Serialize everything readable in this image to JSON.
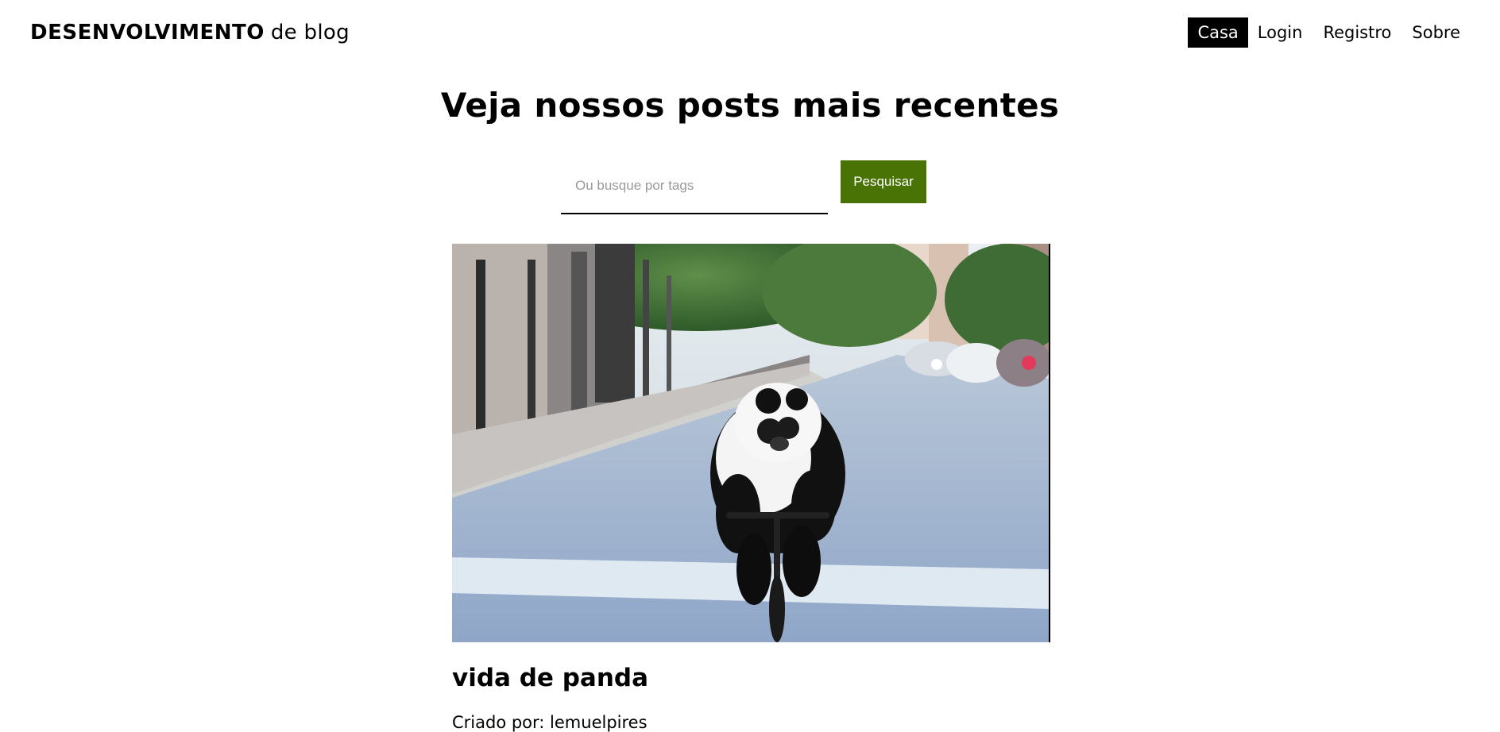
{
  "navbar": {
    "brand_bold": "DESENVOLVIMENTO",
    "brand_light": "de blog",
    "links": [
      {
        "label": "Casa",
        "active": true
      },
      {
        "label": "Login",
        "active": false
      },
      {
        "label": "Registro",
        "active": false
      },
      {
        "label": "Sobre",
        "active": false
      }
    ]
  },
  "main": {
    "title": "Veja nossos posts mais recentes",
    "search": {
      "placeholder": "Ou busque por tags",
      "value": "",
      "button_label": "Pesquisar"
    }
  },
  "post": {
    "image_alt": "panda riding a bicycle on a city street",
    "title": "vida de panda",
    "author_line": "Criado por: lemuelpires"
  },
  "colors": {
    "accent_button": "#4a7305",
    "active_nav_bg": "#000000",
    "active_nav_text": "#ffffff",
    "text": "#000000"
  }
}
